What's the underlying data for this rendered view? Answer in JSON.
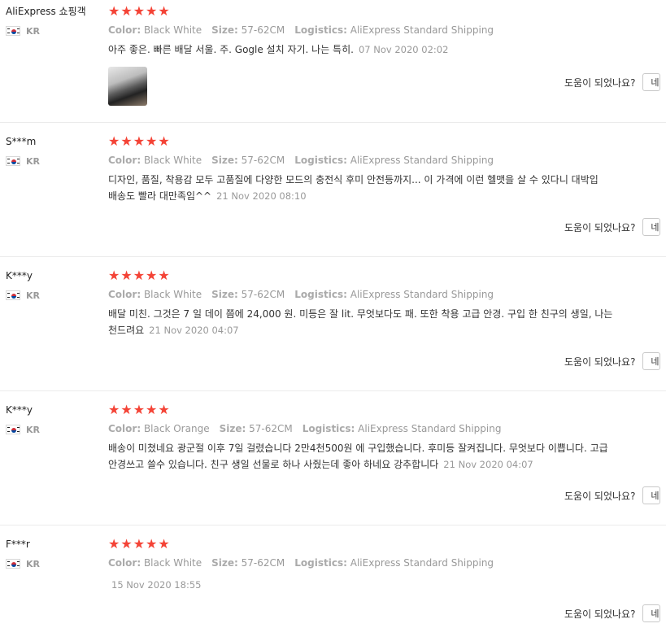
{
  "labels": {
    "color": "Color:",
    "size": "Size:",
    "logistics": "Logistics:",
    "helpful_question": "도움이 되었나요?",
    "helpful_button": "네"
  },
  "reviews": [
    {
      "buyer": "AliExpress 쇼핑객",
      "country": "KR",
      "rating": 5,
      "color": "Black White",
      "size": "57-62CM",
      "logistics": "AliExpress Standard Shipping",
      "text_line1": "아주 좋은. 빠른 배달 서울. 주. Gogle 설치 자기. 나는 특히.",
      "text_line2": "",
      "date": "07 Nov 2020 02:02",
      "has_photo": true
    },
    {
      "buyer": "S***m",
      "country": "KR",
      "rating": 5,
      "color": "Black White",
      "size": "57-62CM",
      "logistics": "AliExpress Standard Shipping",
      "text_line1": "디자인, 품질, 착용감 모두 고품질에 다양한 모드의 충전식 후미 안전등까지... 이 가격에 이런 헬맷을 살 수 있다니 대박입",
      "text_line2": "배송도 빨라 대만족임^^",
      "date": "21 Nov 2020 08:10",
      "has_photo": false
    },
    {
      "buyer": "K***y",
      "country": "KR",
      "rating": 5,
      "color": "Black White",
      "size": "57-62CM",
      "logistics": "AliExpress Standard Shipping",
      "text_line1": "배달 미친. 그것은 7 일 데이 쯤에 24,000 원. 미등은 잘 lit. 무엇보다도 패. 또한 착용 고급 안경. 구입 한 친구의 생일, 나는",
      "text_line2": "천드려요",
      "date": "21 Nov 2020 04:07",
      "has_photo": false
    },
    {
      "buyer": "K***y",
      "country": "KR",
      "rating": 5,
      "color": "Black Orange",
      "size": "57-62CM",
      "logistics": "AliExpress Standard Shipping",
      "text_line1": "배송이 미쳤네요 광군절 이후 7일 걸렸습니다 2만4천500원 에 구입했습니다. 후미등 잘켜집니다. 무엇보다 이쁩니다. 고급",
      "text_line2": "안경쓰고 쓸수 있습니다. 친구 생일 선물로 하나 사줬는데 좋아 하네요 강추합니다",
      "date": "21 Nov 2020 04:07",
      "has_photo": false
    },
    {
      "buyer": "F***r",
      "country": "KR",
      "rating": 5,
      "color": "Black White",
      "size": "57-62CM",
      "logistics": "AliExpress Standard Shipping",
      "text_line1": "",
      "text_line2": "",
      "date": "15 Nov 2020 18:55",
      "has_photo": false
    }
  ]
}
